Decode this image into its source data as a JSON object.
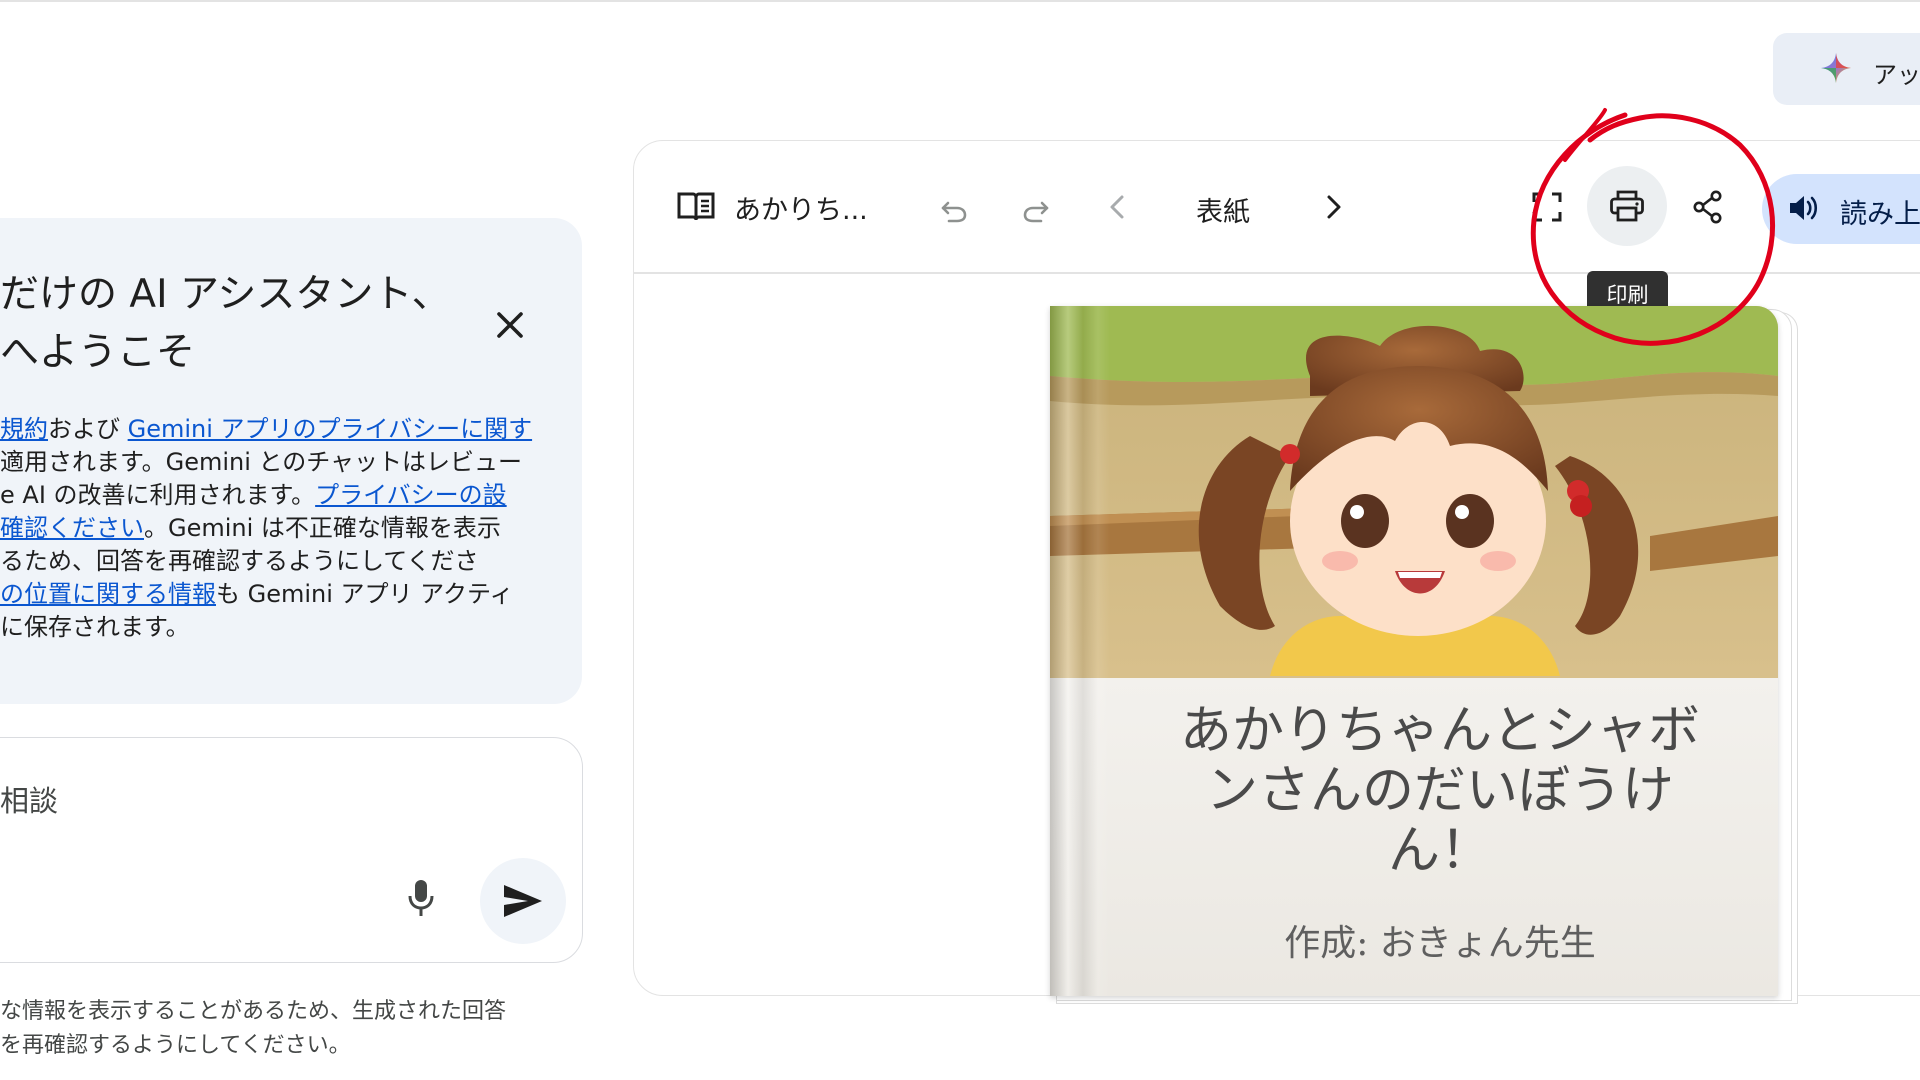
{
  "upgrade": {
    "label": "アッ"
  },
  "welcome": {
    "title_lines": [
      "だけの AI アシスタント、",
      "へようこそ"
    ],
    "notice": {
      "l1_a": "規約",
      "l1_b": "および ",
      "l1_c": "Gemini アプリのプライバシーに関す",
      "l2": "適用されます。Gemini とのチャットはレビュー",
      "l3_a": "e AI の改善に利用されます。",
      "l3_b": "プライバシーの設",
      "l4_a": "確認ください",
      "l4_b": "。Gemini は不正確な情報を表示",
      "l5": "るため、回答を再確認するようにしてくださ",
      "l6_a": "の位置に関する情報",
      "l6_b": "も Gemini アプリ アクティ",
      "l7": "に保存されます。"
    }
  },
  "input": {
    "placeholder": "相談"
  },
  "disclaimer": {
    "line1": "な情報を表示することがあるため、生成された回答",
    "line2": "を再確認するようにしてください。"
  },
  "canvas": {
    "doc_title": "あかりち...",
    "page_label": "表紙",
    "tooltip": "印刷",
    "read_aloud": "読み上"
  },
  "book": {
    "title_lines": [
      "あかりちゃんとシャボ",
      "ンさんのだいぼうけ",
      "ん！"
    ],
    "author": "作成: おきょん先生"
  },
  "colors": {
    "accent": "#0b57d0",
    "annotation": "#e0001b",
    "read_btn_bg": "#d3e3fd"
  },
  "icons": [
    "spark-icon",
    "close-icon",
    "mic-icon",
    "send-icon",
    "book-icon",
    "undo-icon",
    "redo-icon",
    "chevron-left-icon",
    "chevron-right-icon",
    "fullscreen-icon",
    "print-icon",
    "share-icon",
    "speaker-icon"
  ]
}
